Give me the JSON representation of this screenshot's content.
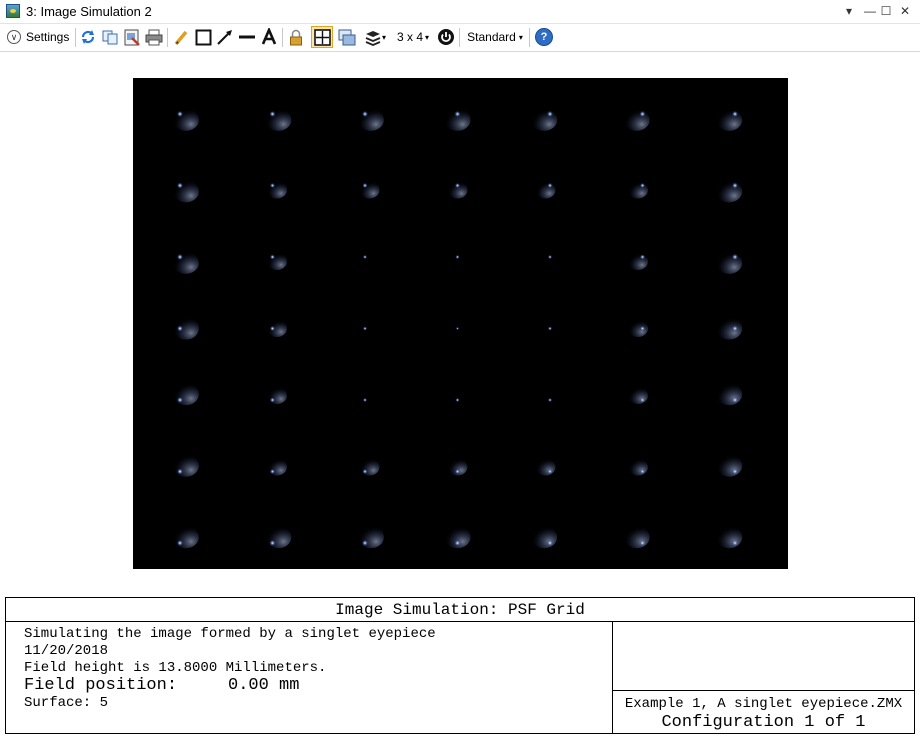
{
  "window": {
    "title": "3: Image Simulation 2",
    "controls": [
      "▾",
      "—",
      "☐",
      "✕"
    ]
  },
  "toolbar": {
    "settings_label": "Settings",
    "grid_label": "3 x 4",
    "standard_label": "Standard",
    "dropdown_glyph": "▾",
    "help_glyph": "?"
  },
  "simulation": {
    "grid_rows": 7,
    "grid_cols": 7,
    "background_color": "#000000",
    "spot_color": "#cfe4ff"
  },
  "info": {
    "title": "Image Simulation: PSF Grid",
    "line1": "Simulating the image formed by a singlet eyepiece",
    "date": "11/20/2018",
    "field_height": "Field height is 13.8000 Millimeters.",
    "field_position": "Field position:     0.00 mm",
    "surface": "Surface: 5",
    "lens_file": "Example 1, A singlet eyepiece.ZMX",
    "configuration": "Configuration 1 of 1"
  }
}
